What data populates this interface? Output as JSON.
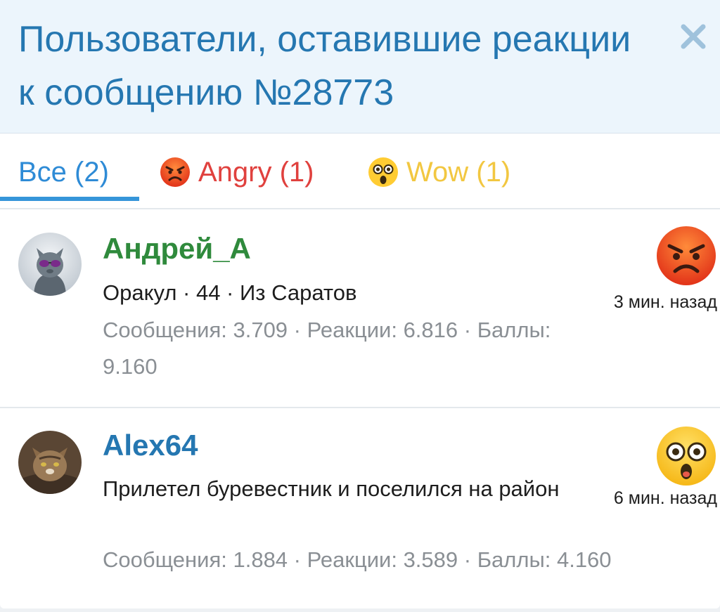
{
  "header": {
    "title": "Пользователи, оставившие реакции к сообщению №28773"
  },
  "tabs": [
    {
      "label": "Все (2)",
      "active": true
    },
    {
      "label": "Angry (1)",
      "emoji": "angry-emoji"
    },
    {
      "label": "Wow (1)",
      "emoji": "wow-emoji"
    }
  ],
  "users": [
    {
      "name": "Андрей_А",
      "info": "Оракул · 44 · Из Саратов",
      "stats": "Сообщения: 3.709 · Реакции: 6.816 · Баллы: 9.160",
      "time": "3 мин. назад",
      "reaction": "angry-emoji",
      "avatar": "cat-with-sunglasses"
    },
    {
      "name": "Alex64",
      "info": "Прилетел буревестник и поселился на район",
      "stats": "Сообщения: 1.884 · Реакции: 3.589 · Баллы: 4.160",
      "time": "6 мин. назад",
      "reaction": "wow-emoji",
      "avatar": "tabby-cat"
    }
  ],
  "colors": {
    "header_title": "#2577b1",
    "tab_active": "#2e8bd6",
    "angry": "#e0413e",
    "wow": "#f2c741",
    "username_green": "#2f8a3c",
    "username_blue": "#2577b1",
    "muted": "#8a8f94"
  }
}
